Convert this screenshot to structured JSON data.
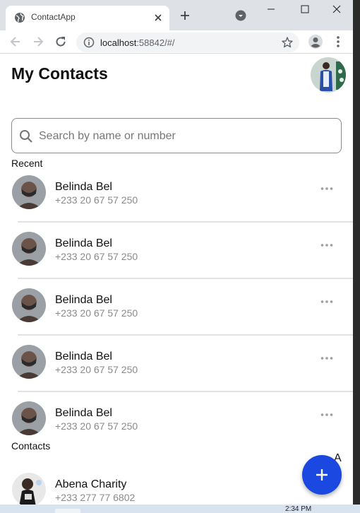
{
  "browser": {
    "tab_title": "ContactApp",
    "url_host": "localhost",
    "url_rest": ":58842/#/"
  },
  "app": {
    "title": "My Contacts",
    "search": {
      "placeholder": "Search by name or number",
      "value": ""
    },
    "recent_label": "Recent",
    "contacts_label": "Contacts",
    "recent": [
      {
        "name": "Belinda Bel",
        "phone": "+233 20 67 57 250"
      },
      {
        "name": "Belinda Bel",
        "phone": "+233 20 67 57 250"
      },
      {
        "name": "Belinda Bel",
        "phone": "+233 20 67 57 250"
      },
      {
        "name": "Belinda Bel",
        "phone": "+233 20 67 57 250"
      },
      {
        "name": "Belinda Bel",
        "phone": "+233 20 67 57 250"
      }
    ],
    "contacts": [
      {
        "name": "Abena Charity",
        "phone": "+233 277 77 6802"
      }
    ],
    "index_letter": "A",
    "fab_icon": "plus-icon",
    "accent_color": "#1a48e0"
  },
  "taskbar": {
    "clock": "2:34 PM"
  }
}
